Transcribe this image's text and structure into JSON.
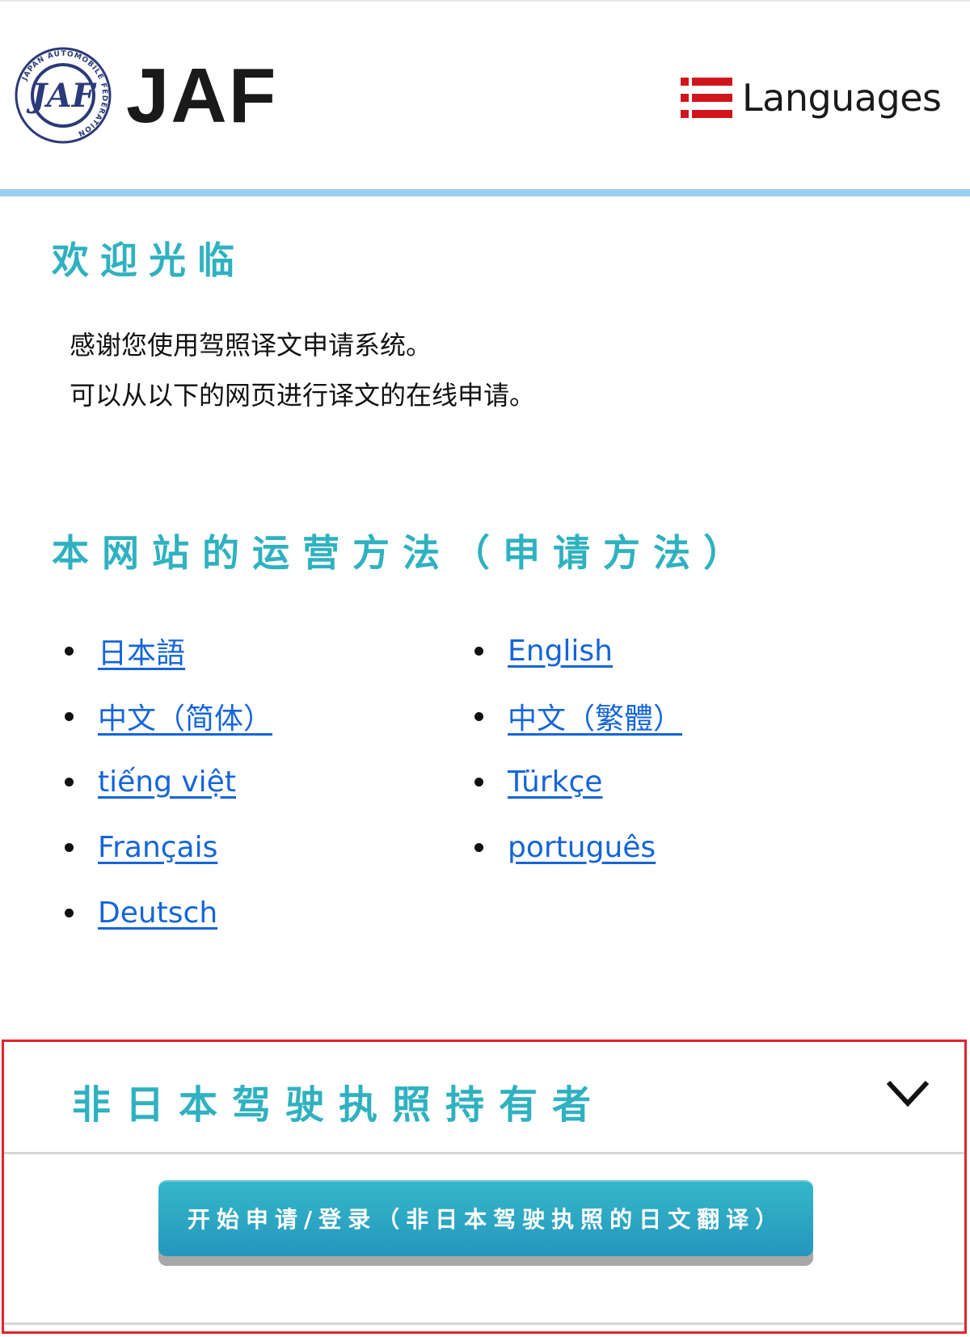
{
  "header": {
    "logo_text": "JAF",
    "emblem_ring_text": "JAPAN AUTOMOBILE FEDERATION",
    "languages_label": "Languages",
    "colors": {
      "brand_red": "#d0141c",
      "accent_bar": "#9ccef0"
    }
  },
  "welcome": {
    "title": "欢迎光临",
    "lines": [
      "感谢您使用驾照译文申请系统。",
      "可以从以下的网页进行译文的在线申请。"
    ]
  },
  "method": {
    "title": "本网站的运营方法（申请方法）",
    "languages": [
      "日本語",
      "English",
      "中文（简体）",
      "中文（繁體）",
      "tiếng việt",
      "Türkçe",
      "Français",
      "português",
      "Deutsch"
    ]
  },
  "foreign_license": {
    "title": "非日本驾驶执照持有者",
    "expand_icon": "chevron-down-icon",
    "start_button_label": "开始申请/登录（非日本驾驶执照的日文翻译）"
  },
  "colors": {
    "heading": "#2fb1c0",
    "link": "#1565d8",
    "highlight_border": "#e3232b",
    "button": "#2fa9c6"
  }
}
